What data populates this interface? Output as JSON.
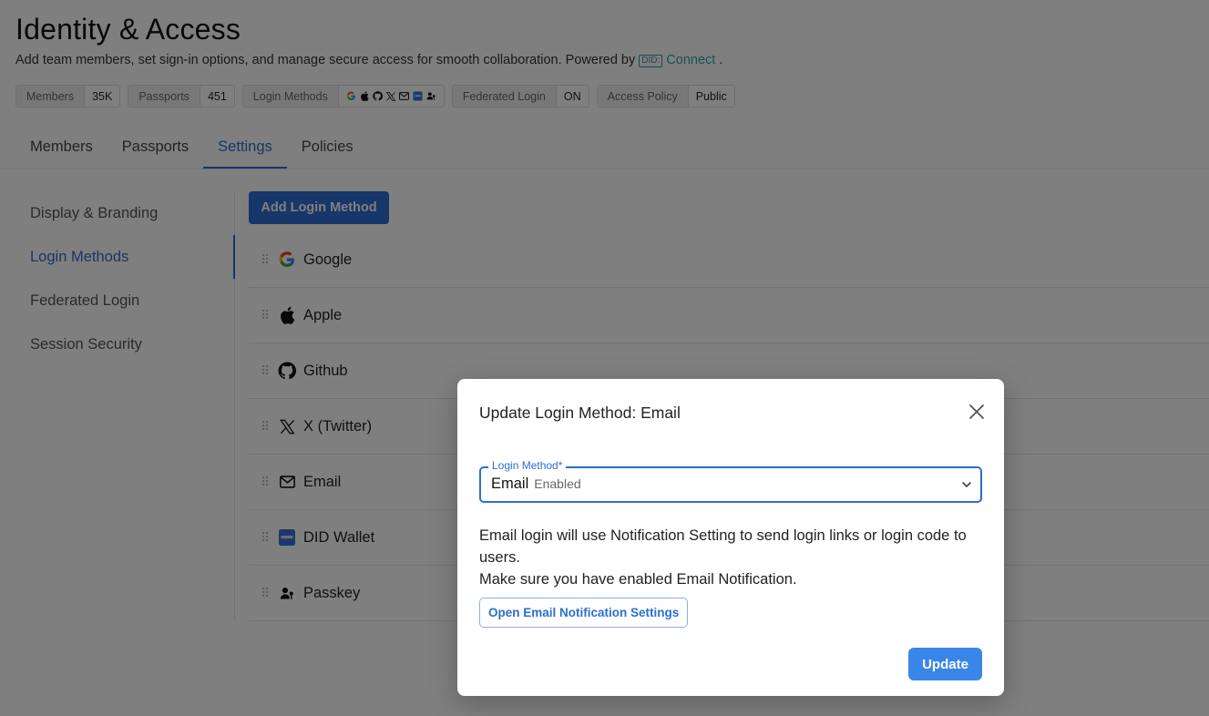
{
  "header": {
    "title": "Identity & Access",
    "subtitle": "Add team members, set sign-in options, and manage secure access for smooth collaboration. Powered by",
    "did_badge": "DID:",
    "connect_label": "Connect",
    "period": "."
  },
  "stats": [
    {
      "label": "Members",
      "value": "35K"
    },
    {
      "label": "Passports",
      "value": "451"
    },
    {
      "label": "Login Methods",
      "icons": [
        "google-icon",
        "apple-icon",
        "github-icon",
        "x-icon",
        "email-icon",
        "did-wallet-icon",
        "passkey-icon"
      ]
    },
    {
      "label": "Federated Login",
      "value": "ON"
    },
    {
      "label": "Access Policy",
      "value": "Public"
    }
  ],
  "tabs": [
    {
      "label": "Members",
      "active": false
    },
    {
      "label": "Passports",
      "active": false
    },
    {
      "label": "Settings",
      "active": true
    },
    {
      "label": "Policies",
      "active": false
    }
  ],
  "side_nav": [
    {
      "label": "Display & Branding",
      "active": false
    },
    {
      "label": "Login Methods",
      "active": true
    },
    {
      "label": "Federated Login",
      "active": false
    },
    {
      "label": "Session Security",
      "active": false
    }
  ],
  "add_button_label": "Add Login Method",
  "login_methods": [
    {
      "label": "Google",
      "icon": "google-icon"
    },
    {
      "label": "Apple",
      "icon": "apple-icon"
    },
    {
      "label": "Github",
      "icon": "github-icon"
    },
    {
      "label": "X (Twitter)",
      "icon": "x-icon"
    },
    {
      "label": "Email",
      "icon": "email-icon"
    },
    {
      "label": "DID Wallet",
      "icon": "did-wallet-icon"
    },
    {
      "label": "Passkey",
      "icon": "passkey-icon"
    }
  ],
  "modal": {
    "title": "Update Login Method: Email",
    "field_label": "Login Method*",
    "field_value": "Email",
    "field_status": "Enabled",
    "description_line1": "Email login will use Notification Setting to send login links or login code to users.",
    "description_line2": "Make sure you have enabled Email Notification.",
    "open_settings_label": "Open Email Notification Settings",
    "update_label": "Update"
  },
  "colors": {
    "accent": "#2a6fcf",
    "primary_button": "#2e6dd3",
    "update_button": "#3a86e8",
    "connect_link": "#2aa5b5"
  }
}
